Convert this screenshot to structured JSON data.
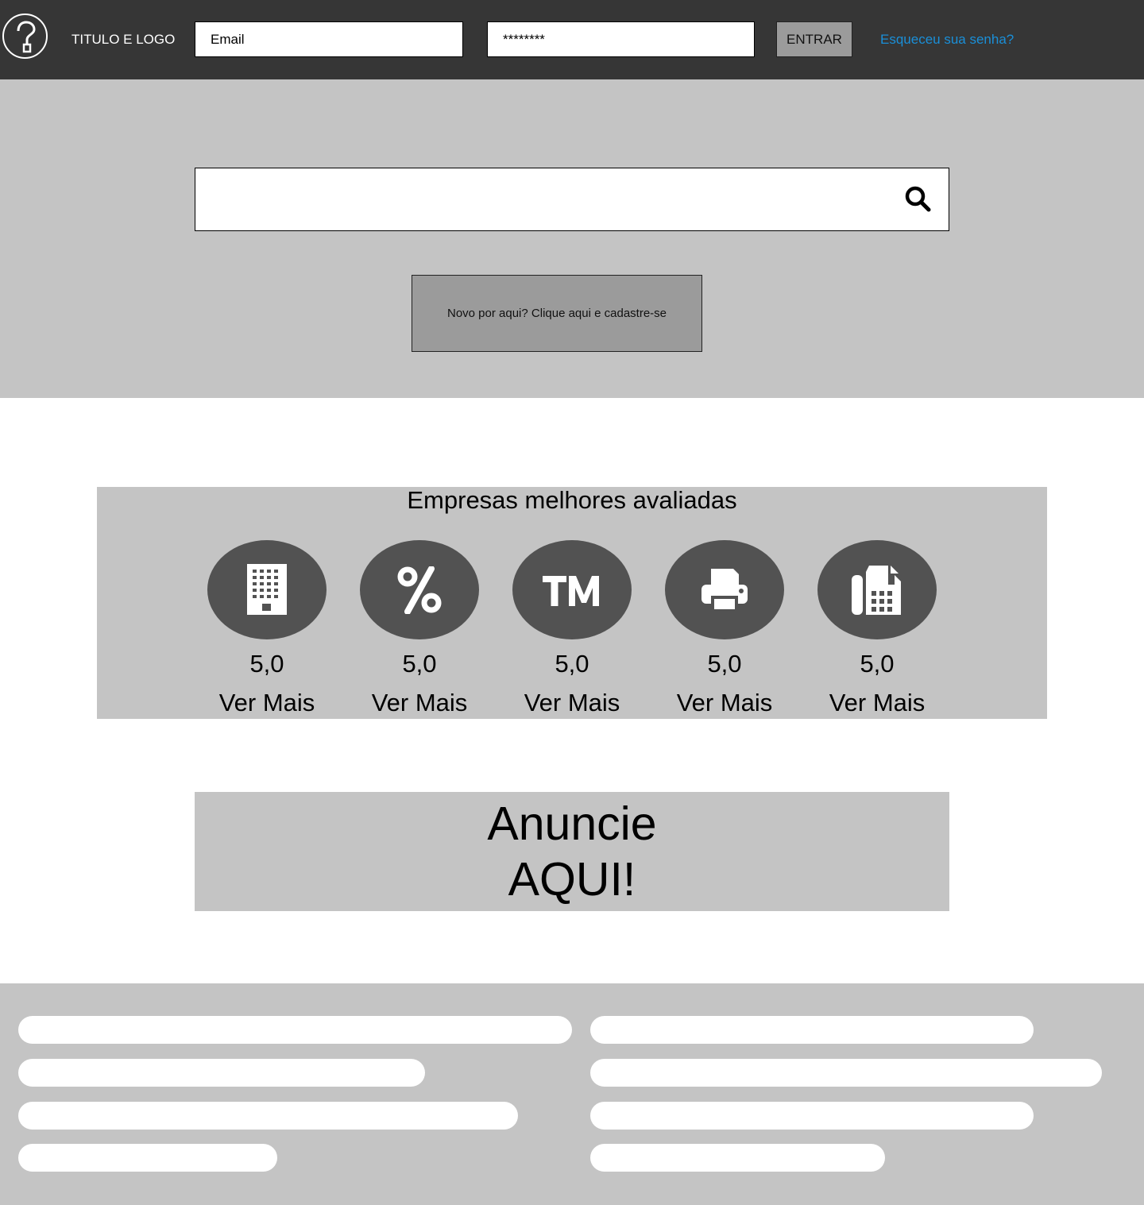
{
  "header": {
    "logo_icon": "question-icon",
    "title": "TITULO E LOGO",
    "email_value": "Email",
    "password_value": "********",
    "login_label": "ENTRAR",
    "forgot_label": "Esqueceu sua senha?"
  },
  "hero": {
    "search_value": "",
    "search_icon": "search-icon",
    "signup_label": "Novo por aqui? Clique aqui e cadastre-se"
  },
  "companies": {
    "title": "Empresas melhores avaliadas",
    "items": [
      {
        "icon": "building-icon",
        "rating": "5,0",
        "more": "Ver Mais"
      },
      {
        "icon": "percent-icon",
        "rating": "5,0",
        "more": "Ver Mais"
      },
      {
        "icon": "trademark-icon",
        "rating": "5,0",
        "more": "Ver Mais"
      },
      {
        "icon": "printer-icon",
        "rating": "5,0",
        "more": "Ver Mais"
      },
      {
        "icon": "fax-icon",
        "rating": "5,0",
        "more": "Ver Mais"
      }
    ]
  },
  "ad": {
    "line1": "Anuncie",
    "line2": "AQUI!"
  },
  "colors": {
    "header_bg": "#363636",
    "panel_bg": "#c4c4c4",
    "button_bg": "#9b9b9b",
    "icon_disc": "#525252",
    "link": "#1a8fd8"
  }
}
